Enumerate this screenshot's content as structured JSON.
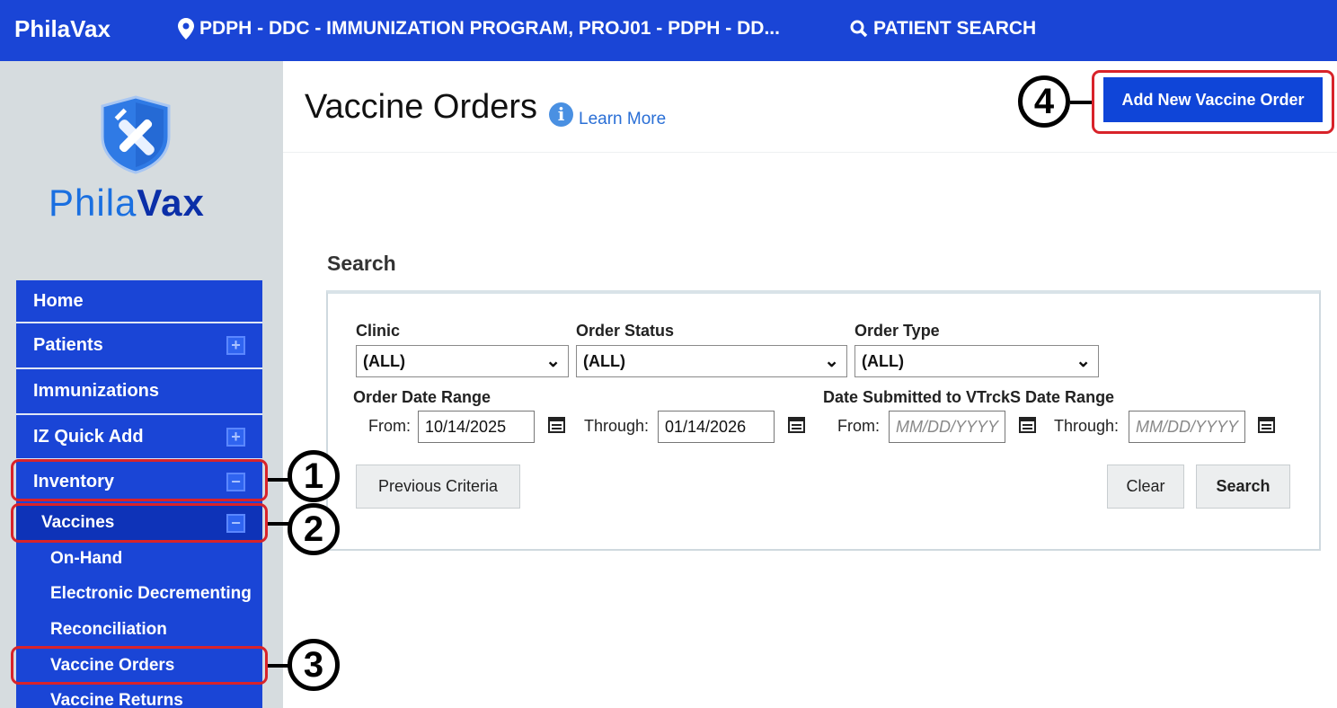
{
  "topbar": {
    "brand": "PhilaVax",
    "location": "PDPH - DDC - IMMUNIZATION PROGRAM, PROJ01 - PDPH - DD...",
    "patient_search": "PATIENT SEARCH"
  },
  "logo": {
    "part1": "Phila",
    "part2": "Vax"
  },
  "nav": {
    "home": "Home",
    "patients": "Patients",
    "immunizations": "Immunizations",
    "iz_quick_add": "IZ Quick Add",
    "inventory": "Inventory",
    "vaccines": "Vaccines",
    "on_hand": "On-Hand",
    "electronic_decrementing": "Electronic Decrementing",
    "reconciliation": "Reconciliation",
    "vaccine_orders": "Vaccine Orders",
    "vaccine_returns": "Vaccine Returns"
  },
  "annotations": [
    "1",
    "2",
    "3",
    "4"
  ],
  "header": {
    "title": "Vaccine Orders",
    "learn_more": "Learn More",
    "add_button": "Add New Vaccine Order"
  },
  "search": {
    "heading": "Search",
    "clinic_label": "Clinic",
    "clinic_value": "(ALL)",
    "status_label": "Order Status",
    "status_value": "(ALL)",
    "type_label": "Order Type",
    "type_value": "(ALL)",
    "order_date_range_label": "Order Date Range",
    "from_label": "From:",
    "from_value": "10/14/2025",
    "through_label": "Through:",
    "through_value": "01/14/2026",
    "submitted_range_label": "Date Submitted to VTrckS Date Range",
    "submitted_from_label": "From:",
    "submitted_from_placeholder": "MM/DD/YYYY",
    "submitted_through_label": "Through:",
    "submitted_through_placeholder": "MM/DD/YYYY",
    "previous_criteria": "Previous Criteria",
    "clear": "Clear",
    "search_button": "Search"
  },
  "colors": {
    "brand_blue": "#1a45d6",
    "annotation_red": "#d8232a",
    "sidebar_bg": "#d6dcdf"
  }
}
